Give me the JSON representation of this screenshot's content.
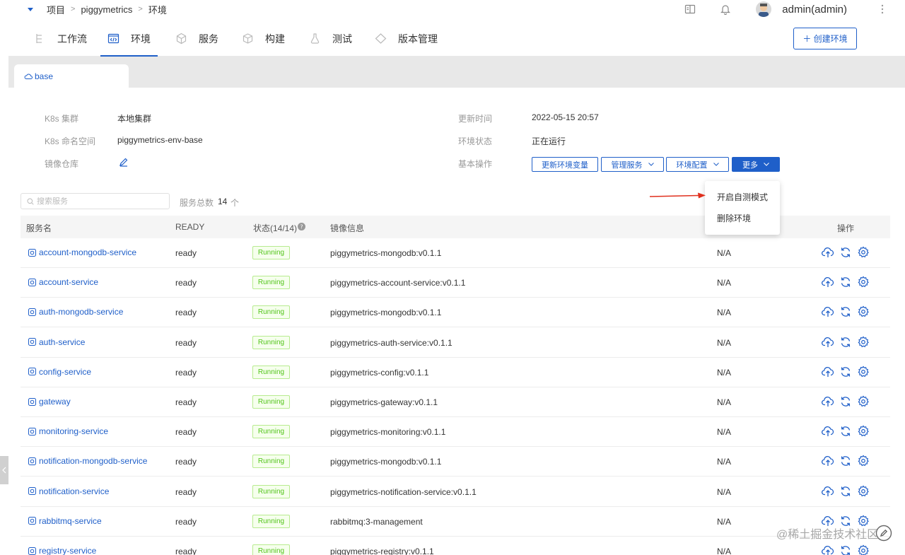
{
  "breadcrumb": {
    "project": "项目",
    "name": "piggymetrics",
    "page": "环境",
    "sep": ">"
  },
  "user": {
    "name": "admin(admin)"
  },
  "tabs": [
    {
      "label": "工作流",
      "icon": "workflow-icon"
    },
    {
      "label": "环境",
      "icon": "code-icon",
      "active": true
    },
    {
      "label": "服务",
      "icon": "cube-icon"
    },
    {
      "label": "构建",
      "icon": "box-icon"
    },
    {
      "label": "测试",
      "icon": "flask-icon"
    },
    {
      "label": "版本管理",
      "icon": "diamond-icon"
    }
  ],
  "create_env_label": "＋ 创建环境",
  "env_tab": {
    "label": "base"
  },
  "info": {
    "cluster_label": "K8s 集群",
    "cluster_value": "本地集群",
    "namespace_label": "K8s 命名空间",
    "namespace_value": "piggymetrics-env-base",
    "registry_label": "镜像仓库",
    "updated_label": "更新时间",
    "updated_value": "2022-05-15 20:57",
    "status_label": "环境状态",
    "status_value": "正在运行",
    "ops_label": "基本操作"
  },
  "ops": {
    "update_vars": "更新环境变量",
    "manage_services": "管理服务",
    "env_config": "环境配置",
    "more": "更多"
  },
  "more_menu": {
    "self_test": "开启自测模式",
    "delete_env": "删除环境"
  },
  "search": {
    "placeholder": "搜索服务"
  },
  "service_total": {
    "label": "服务总数",
    "value": "14",
    "unit": "个"
  },
  "table": {
    "headers": {
      "name": "服务名",
      "ready": "READY",
      "status": "状态(14/14)",
      "image": "镜像信息",
      "ops": "操作"
    },
    "rows": [
      {
        "name": "account-mongodb-service",
        "ready": "ready",
        "status": "Running",
        "image": "piggymetrics-mongodb:v0.1.1",
        "extra": "N/A"
      },
      {
        "name": "account-service",
        "ready": "ready",
        "status": "Running",
        "image": "piggymetrics-account-service:v0.1.1",
        "extra": "N/A"
      },
      {
        "name": "auth-mongodb-service",
        "ready": "ready",
        "status": "Running",
        "image": "piggymetrics-mongodb:v0.1.1",
        "extra": "N/A"
      },
      {
        "name": "auth-service",
        "ready": "ready",
        "status": "Running",
        "image": "piggymetrics-auth-service:v0.1.1",
        "extra": "N/A"
      },
      {
        "name": "config-service",
        "ready": "ready",
        "status": "Running",
        "image": "piggymetrics-config:v0.1.1",
        "extra": "N/A"
      },
      {
        "name": "gateway",
        "ready": "ready",
        "status": "Running",
        "image": "piggymetrics-gateway:v0.1.1",
        "extra": "N/A"
      },
      {
        "name": "monitoring-service",
        "ready": "ready",
        "status": "Running",
        "image": "piggymetrics-monitoring:v0.1.1",
        "extra": "N/A"
      },
      {
        "name": "notification-mongodb-service",
        "ready": "ready",
        "status": "Running",
        "image": "piggymetrics-mongodb:v0.1.1",
        "extra": "N/A"
      },
      {
        "name": "notification-service",
        "ready": "ready",
        "status": "Running",
        "image": "piggymetrics-notification-service:v0.1.1",
        "extra": "N/A"
      },
      {
        "name": "rabbitmq-service",
        "ready": "ready",
        "status": "Running",
        "image": "rabbitmq:3-management",
        "extra": "N/A"
      },
      {
        "name": "registry-service",
        "ready": "ready",
        "status": "Running",
        "image": "piggymetrics-registry:v0.1.1",
        "extra": "N/A"
      }
    ]
  },
  "watermark": "@稀土掘金技术社区",
  "colors": {
    "primary": "#1f5fc9",
    "running_text": "#52c41a",
    "running_bg": "#f6ffed",
    "arrow": "#e0301e"
  }
}
